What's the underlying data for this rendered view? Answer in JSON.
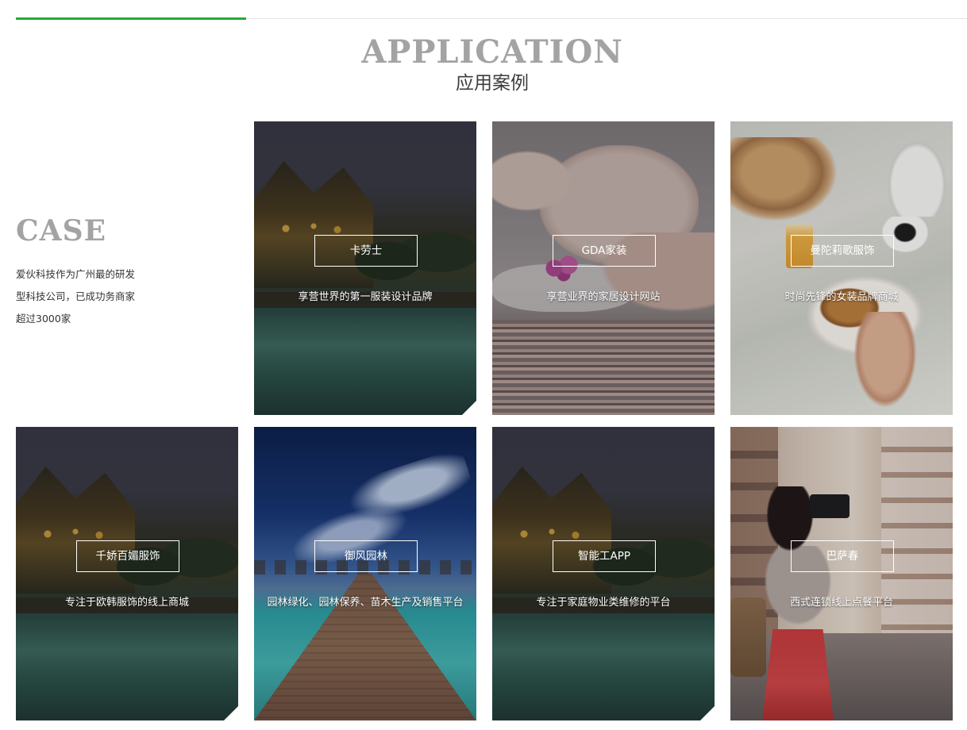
{
  "header": {
    "title_en": "APPLICATION",
    "title_cn": "应用案例"
  },
  "intro": {
    "title": "CASE",
    "desc_lines": [
      "爱伙科技作为广州最的研发",
      "型科技公司，已成功务商家",
      "超过3000家"
    ]
  },
  "cases": [
    {
      "name": "卡劳士",
      "desc": "享营世界的第一服装设计品牌",
      "scene": "resort-pool-photo"
    },
    {
      "name": "GDA家装",
      "desc": "享营业界的家居设计网站",
      "scene": "spa-face-photo"
    },
    {
      "name": "曼陀莉歌服饰",
      "desc": "时尚先锋的女装品牌商城",
      "scene": "breakfast-table-photo"
    },
    {
      "name": "千娇百媚服饰",
      "desc": "专注于欧韩服饰的线上商城",
      "scene": "resort-pool-photo"
    },
    {
      "name": "御风园林",
      "desc": "园林绿化、园林保养、苗木生产及销售平台",
      "scene": "overwater-pier-photo"
    },
    {
      "name": "智能工APP",
      "desc": "专注于家庭物业类维修的平台",
      "scene": "resort-pool-photo"
    },
    {
      "name": "巴萨春",
      "desc": "西式连锁线上点餐平台",
      "scene": "street-photographer-photo"
    }
  ],
  "colors": {
    "accent": "#2aa836",
    "title_gray": "#a3a3a3"
  }
}
